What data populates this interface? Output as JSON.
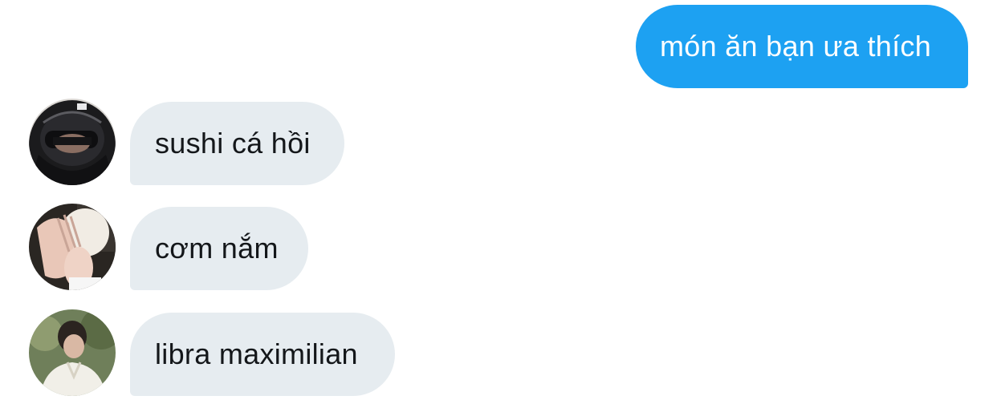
{
  "conversation": {
    "outgoing": {
      "text": "món ăn bạn ưa thích",
      "color": "#1da1f2"
    },
    "incoming_color": "#e6ecf0",
    "replies": [
      {
        "text": "sushi cá hồi",
        "avatar": "helmet-avatar"
      },
      {
        "text": "cơm nắm",
        "avatar": "hands-face-avatar"
      },
      {
        "text": "libra maximilian",
        "avatar": "outdoor-portrait-avatar"
      }
    ]
  }
}
